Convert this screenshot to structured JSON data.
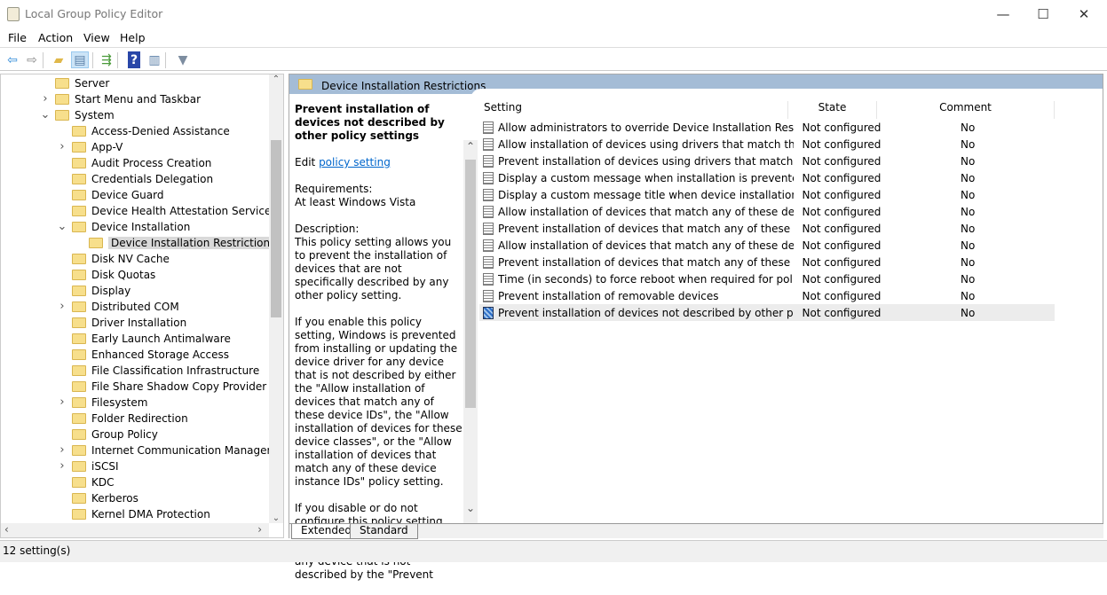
{
  "window": {
    "title": "Local Group Policy Editor",
    "minimize": "—",
    "maximize": "☐",
    "close": "✕"
  },
  "menu": [
    "File",
    "Action",
    "View",
    "Help"
  ],
  "toolbar": [
    {
      "icon": "back-arrow-icon",
      "glyph": "⇦",
      "color": "#2b88d8"
    },
    {
      "icon": "forward-arrow-icon",
      "glyph": "⇨",
      "color": "#888"
    },
    {
      "icon": "up-folder-icon",
      "glyph": "▰",
      "color": "#e0b84a"
    },
    {
      "icon": "show-hide-console-tree-icon",
      "glyph": "▤",
      "color": "#5a7fa8"
    },
    {
      "icon": "export-list-icon",
      "glyph": "⇶",
      "color": "#4a9a3a"
    },
    {
      "icon": "help-icon",
      "glyph": "?",
      "color": "#fff"
    },
    {
      "icon": "show-hide-action-pane-icon",
      "glyph": "▥",
      "color": "#5a7fa8"
    },
    {
      "icon": "filter-icon",
      "glyph": "▼",
      "color": "#7d8da0"
    }
  ],
  "tree": [
    {
      "label": "Server",
      "level": 0,
      "chevron": ""
    },
    {
      "label": "Start Menu and Taskbar",
      "level": 0,
      "chevron": ">"
    },
    {
      "label": "System",
      "level": 0,
      "chevron": "v"
    },
    {
      "label": "Access-Denied Assistance",
      "level": 1,
      "chevron": ""
    },
    {
      "label": "App-V",
      "level": 1,
      "chevron": ">"
    },
    {
      "label": "Audit Process Creation",
      "level": 1,
      "chevron": ""
    },
    {
      "label": "Credentials Delegation",
      "level": 1,
      "chevron": ""
    },
    {
      "label": "Device Guard",
      "level": 1,
      "chevron": ""
    },
    {
      "label": "Device Health Attestation Service",
      "level": 1,
      "chevron": ""
    },
    {
      "label": "Device Installation",
      "level": 1,
      "chevron": "v"
    },
    {
      "label": "Device Installation Restrictions",
      "level": 2,
      "chevron": "",
      "selected": true
    },
    {
      "label": "Disk NV Cache",
      "level": 1,
      "chevron": ""
    },
    {
      "label": "Disk Quotas",
      "level": 1,
      "chevron": ""
    },
    {
      "label": "Display",
      "level": 1,
      "chevron": ""
    },
    {
      "label": "Distributed COM",
      "level": 1,
      "chevron": ">"
    },
    {
      "label": "Driver Installation",
      "level": 1,
      "chevron": ""
    },
    {
      "label": "Early Launch Antimalware",
      "level": 1,
      "chevron": ""
    },
    {
      "label": "Enhanced Storage Access",
      "level": 1,
      "chevron": ""
    },
    {
      "label": "File Classification Infrastructure",
      "level": 1,
      "chevron": ""
    },
    {
      "label": "File Share Shadow Copy Provider",
      "level": 1,
      "chevron": ""
    },
    {
      "label": "Filesystem",
      "level": 1,
      "chevron": ">"
    },
    {
      "label": "Folder Redirection",
      "level": 1,
      "chevron": ""
    },
    {
      "label": "Group Policy",
      "level": 1,
      "chevron": ""
    },
    {
      "label": "Internet Communication Management",
      "level": 1,
      "chevron": ">"
    },
    {
      "label": "iSCSI",
      "level": 1,
      "chevron": ">"
    },
    {
      "label": "KDC",
      "level": 1,
      "chevron": ""
    },
    {
      "label": "Kerberos",
      "level": 1,
      "chevron": ""
    },
    {
      "label": "Kernel DMA Protection",
      "level": 1,
      "chevron": ""
    }
  ],
  "pane": {
    "header": "Device Installation Restrictions",
    "desc_title": "Prevent installation of devices not described by other policy settings",
    "edit_prefix": "Edit ",
    "edit_link": "policy setting ",
    "requirements_label": "Requirements:",
    "requirements": "At least Windows Vista",
    "description_label": "Description:",
    "paragraphs": [
      "This policy setting allows you to prevent the installation of devices that are not specifically described by any other policy setting.",
      "If you enable this policy setting, Windows is prevented from installing or updating the device driver for any device that is not described by either the \"Allow installation of devices that match any of these device IDs\", the \"Allow installation of devices for these device classes\", or the \"Allow installation of devices that match any of these device instance IDs\" policy setting.",
      "If you disable or do not configure this policy setting, Windows is allowed to install or update the device driver for any device that is not described by the \"Prevent"
    ]
  },
  "columns": {
    "setting": "Setting",
    "state": "State",
    "comment": "Comment"
  },
  "settings": [
    {
      "name": "Allow administrators to override Device Installation Restricti...",
      "state": "Not configured",
      "comment": "No"
    },
    {
      "name": "Allow installation of devices using drivers that match these ...",
      "state": "Not configured",
      "comment": "No"
    },
    {
      "name": "Prevent installation of devices using drivers that match thes...",
      "state": "Not configured",
      "comment": "No"
    },
    {
      "name": "Display a custom message when installation is prevented by...",
      "state": "Not configured",
      "comment": "No"
    },
    {
      "name": "Display a custom message title when device installation is pr...",
      "state": "Not configured",
      "comment": "No"
    },
    {
      "name": "Allow installation of devices that match any of these device ...",
      "state": "Not configured",
      "comment": "No"
    },
    {
      "name": "Prevent installation of devices that match any of these devic...",
      "state": "Not configured",
      "comment": "No"
    },
    {
      "name": "Allow installation of devices that match any of these device ...",
      "state": "Not configured",
      "comment": "No"
    },
    {
      "name": "Prevent installation of devices that match any of these devic...",
      "state": "Not configured",
      "comment": "No"
    },
    {
      "name": "Time (in seconds) to force reboot when required for policy c...",
      "state": "Not configured",
      "comment": "No"
    },
    {
      "name": "Prevent installation of removable devices",
      "state": "Not configured",
      "comment": "No"
    },
    {
      "name": "Prevent installation of devices not described by other policy ...",
      "state": "Not configured",
      "comment": "No",
      "selected": true
    }
  ],
  "tabs": [
    "Extended",
    "Standard"
  ],
  "status": "12 setting(s)"
}
